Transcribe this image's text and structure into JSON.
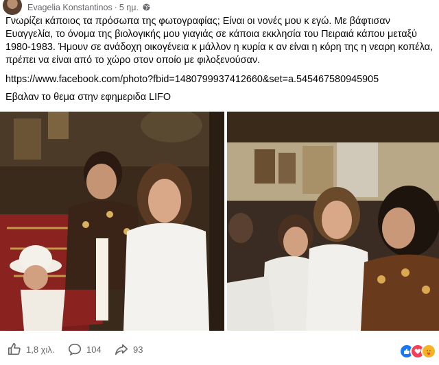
{
  "post": {
    "author": "Evagelia Konstantinos",
    "time": "5 ημ.",
    "text": "Γνωρίζει κάποιος τα πρόσωπα της φωτογραφίας; Είναι οι νονές μου κ εγώ. Με βάφτισαν Ευαγγελία, το όνομα της βιολογικής μου γιαγιάς σε κάποια εκκλησία του Πειραιά κάπου μεταξύ 1980-1983. Ήμουν σε ανάδοχη οικογένεια κ μάλλον η κυρία κ αν είναι η κόρη της η νεαρη κοπέλα, πρέπει να είναι από το χώρο στον οποίο με φιλοξενούσαν.",
    "link": "https://www.facebook.com/photo?fbid=1480799937412660&set=a.545467580945905",
    "note": "Εβαλαν το θεμα στην εφημεριδα LIFO"
  },
  "actions": {
    "likes": "1,8 χιλ.",
    "comments": "104",
    "shares": "93"
  },
  "colors": {
    "meta_gray": "#65676b",
    "like_blue": "#1877f2",
    "love_red": "#f33e58",
    "care_yellow": "#f7b125"
  },
  "icons": {
    "like": "thumbs-up-icon",
    "comment": "comment-icon",
    "share": "share-arrow-icon",
    "privacy": "globe-icon"
  }
}
